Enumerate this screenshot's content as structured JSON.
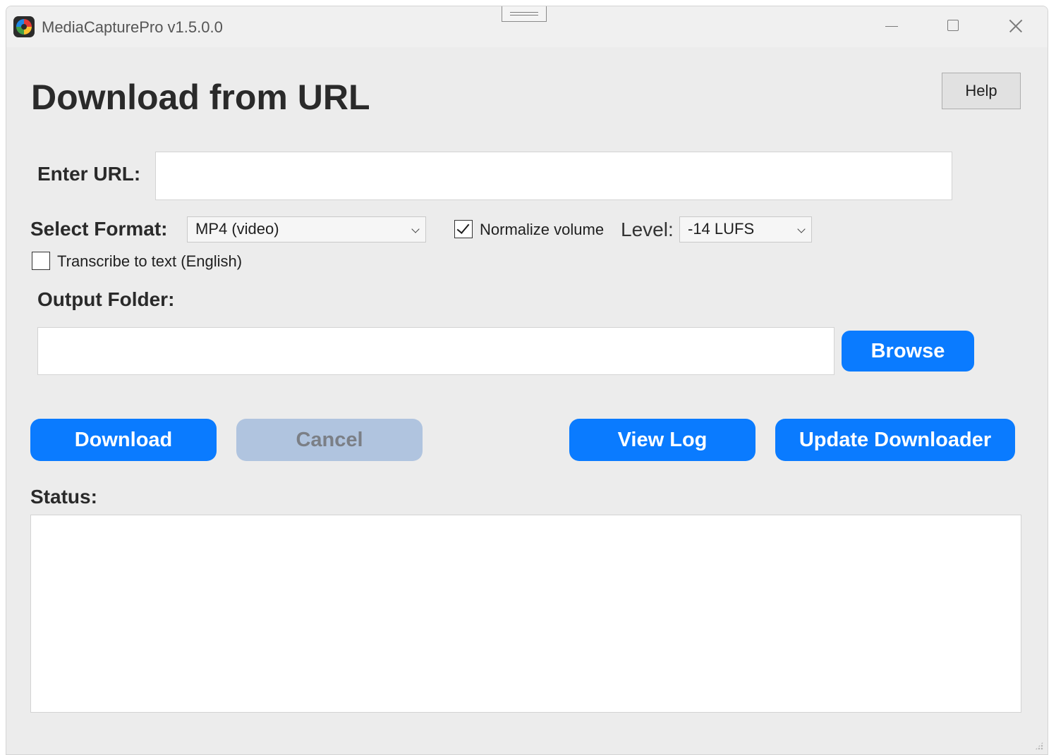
{
  "window": {
    "title": "MediaCapturePro v1.5.0.0"
  },
  "header": {
    "title": "Download from URL",
    "help_label": "Help"
  },
  "url": {
    "label": "Enter URL:",
    "value": ""
  },
  "format": {
    "label": "Select Format:",
    "selected": "MP4 (video)",
    "normalize_label": "Normalize volume",
    "normalize_checked": true,
    "level_label": "Level:",
    "level_selected": "-14 LUFS"
  },
  "transcribe": {
    "label": "Transcribe to text (English)",
    "checked": false
  },
  "output": {
    "label": "Output Folder:",
    "value": "",
    "browse_label": "Browse"
  },
  "actions": {
    "download_label": "Download",
    "cancel_label": "Cancel",
    "view_log_label": "View Log",
    "update_label": "Update Downloader"
  },
  "status": {
    "label": "Status:",
    "text": ""
  },
  "colors": {
    "accent": "#0a7bff",
    "disabled": "#b0c4df",
    "background": "#ececec"
  }
}
